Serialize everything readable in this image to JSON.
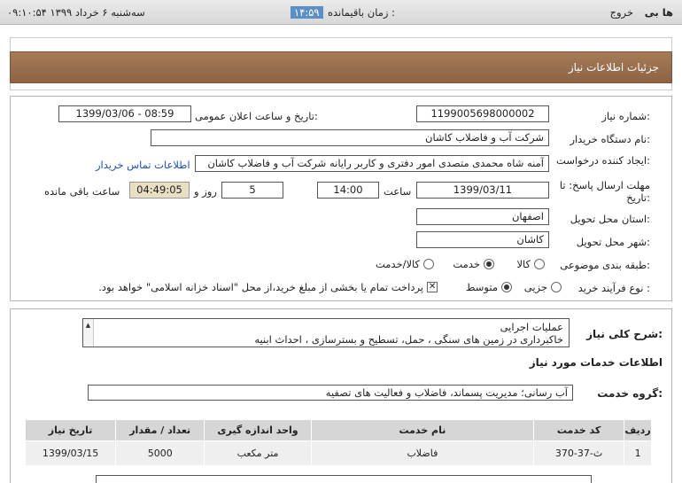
{
  "topbar": {
    "logo": "ها بی",
    "exit": "خروج",
    "remaining_label": "زمان باقیمانده :",
    "remaining_value": "۱۴:۵۹",
    "datetime": "سه‌شنبه ۶ خرداد ۱۳۹۹  ۰۹:۱۰:۵۴"
  },
  "header": {
    "title": "جزئیات اطلاعات نیاز"
  },
  "form": {
    "need_number_label": "شماره نیاز:",
    "need_number": "1199005698000002",
    "announce_label": "تاریخ و ساعت اعلان عمومی:",
    "announce_value": "1399/03/06 - 08:59",
    "buyer_label": "نام دستگاه خریدار:",
    "buyer_value": "شرکت آب و فاضلاب کاشان",
    "creator_label": "ایجاد کننده درخواست:",
    "creator_value": "آمنه شاه محمدی متصدی امور دفتری و کاربر رایانه شرکت آب و فاضلاب کاشان",
    "contact_link": "اطلاعات تماس خریدار",
    "deadline_label": "مهلت ارسال پاسخ: تا تاریخ:",
    "deadline_date": "1399/03/11",
    "time_label": "ساعت",
    "deadline_time": "14:00",
    "days_value": "5",
    "days_label": "روز و",
    "remaining_time": "04:49:05",
    "remaining_label": "ساعت باقی مانده",
    "province_label": "استان محل تحویل:",
    "province_value": "اصفهان",
    "city_label": "شهر محل تحویل:",
    "city_value": "کاشان",
    "category_label": "طبقه بندی موضوعی:",
    "category_options": [
      "کالا",
      "خدمت",
      "کالا/خدمت"
    ],
    "category_selected": "خدمت",
    "process_label": "نوع فرآیند خرید :",
    "process_options": [
      "جزیی",
      "متوسط"
    ],
    "process_selected": "متوسط",
    "payment_note": "پرداخت تمام یا بخشی از مبلغ خرید،از محل \"اسناد خزانه اسلامی\" خواهد بود."
  },
  "need_desc": {
    "label": "شرح کلی نیاز:",
    "line1": "عملیات اجرایی",
    "line2": "خاکبرداری در زمین های سنگی ، حمل، تسطیح و بسترسازی ، احداث ابنیه"
  },
  "services": {
    "section_title": "اطلاعات خدمات مورد نیاز",
    "group_label": "گروه خدمت:",
    "group_value": "آب رسانی؛ مدیریت پسماند، فاضلاب و فعالیت های تصفیه",
    "headers": [
      "ردیف",
      "کد خدمت",
      "نام خدمت",
      "واحد اندازه گیری",
      "تعداد / مقدار",
      "تاریخ نیاز"
    ],
    "rows": [
      [
        "1",
        "ث-37-370",
        "فاضلاب",
        "متر مکعب",
        "5000",
        "1399/03/15"
      ]
    ]
  }
}
